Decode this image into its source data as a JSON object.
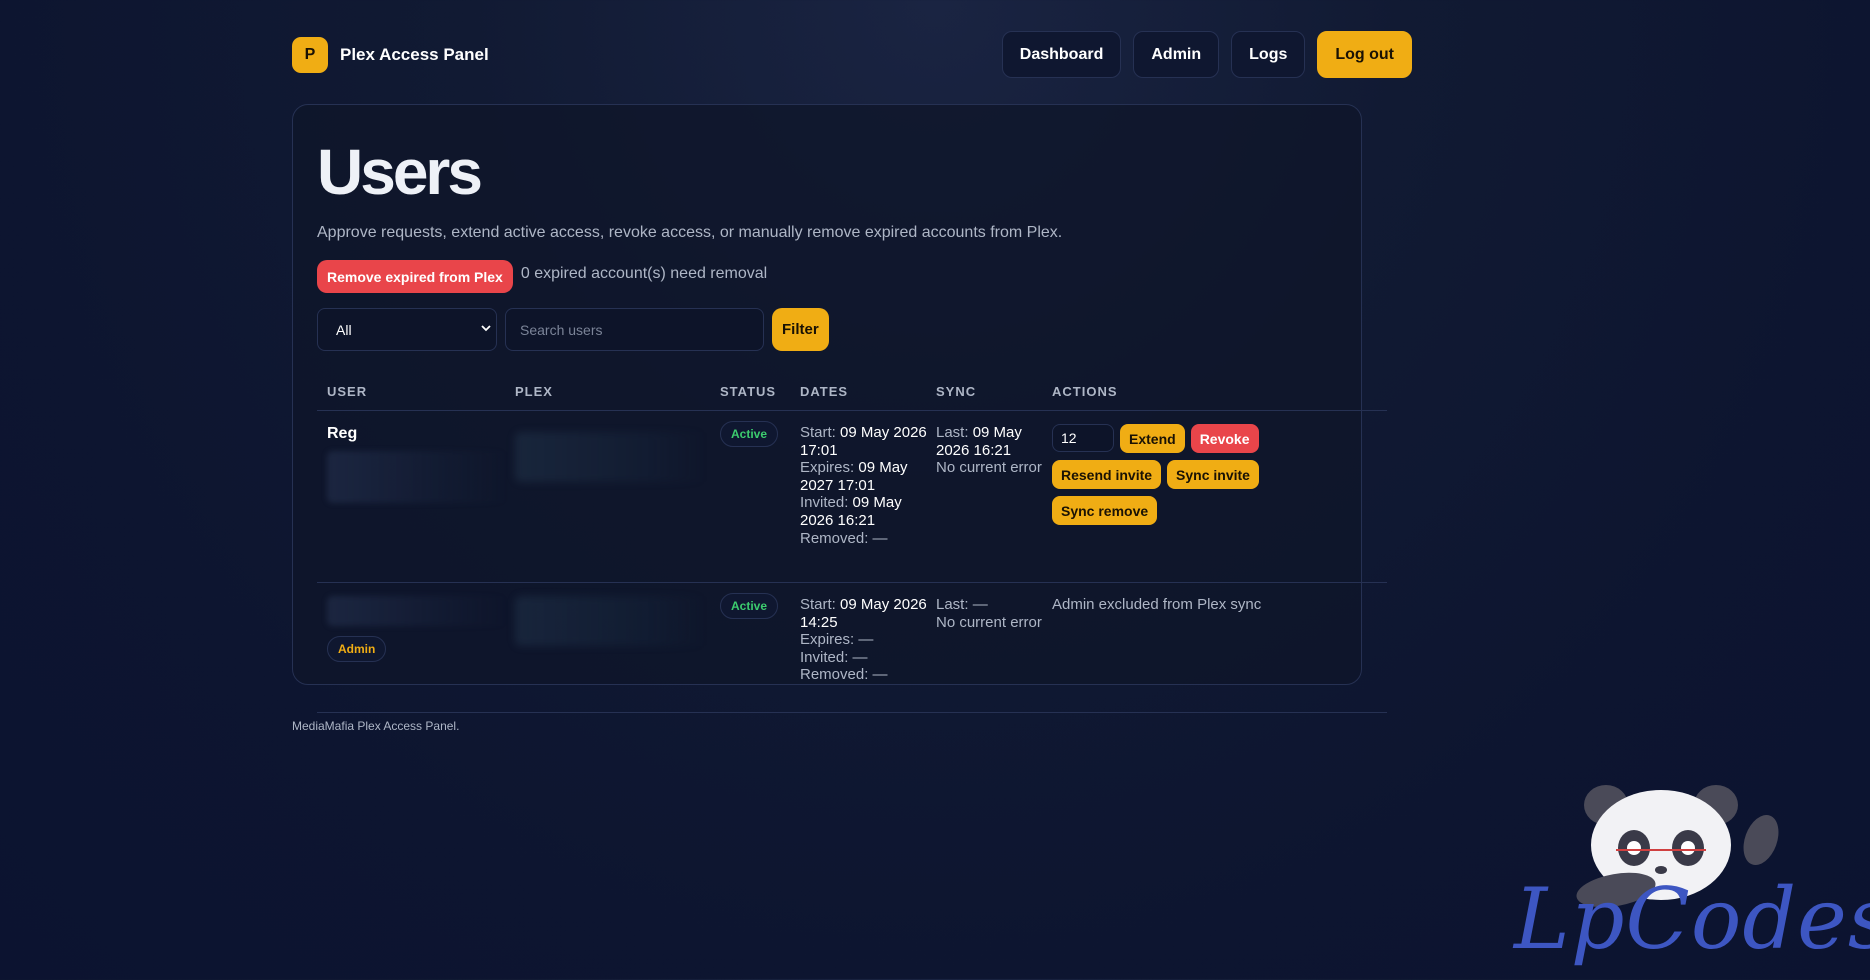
{
  "brand": {
    "logo_letter": "P",
    "name": "Plex Access Panel"
  },
  "nav": {
    "dashboard": "Dashboard",
    "admin": "Admin",
    "logs": "Logs",
    "logout": "Log out"
  },
  "page": {
    "title": "Users",
    "subtitle": "Approve requests, extend active access, revoke access, or manually remove expired accounts from Plex.",
    "remove_expired_label": "Remove expired from Plex",
    "remove_expired_info": "0 expired account(s) need removal"
  },
  "filter": {
    "selected": "All",
    "search_placeholder": "Search users",
    "button": "Filter"
  },
  "table": {
    "headers": {
      "user": "USER",
      "plex": "PLEX",
      "status": "STATUS",
      "dates": "DATES",
      "sync": "SYNC",
      "actions": "ACTIONS"
    },
    "rows": [
      {
        "user": "Reg",
        "status": "Active",
        "dates": {
          "start_label": "Start:",
          "start": "09 May 2026 17:01",
          "expires_label": "Expires:",
          "expires": "09 May 2027 17:01",
          "invited_label": "Invited:",
          "invited": "09 May 2026 16:21",
          "removed_label": "Removed:",
          "removed": "—"
        },
        "sync": {
          "last_label": "Last:",
          "last": "09 May 2026 16:21",
          "error": "No current error"
        },
        "actions": {
          "months_value": "12",
          "extend": "Extend",
          "revoke": "Revoke",
          "resend_invite": "Resend invite",
          "sync_invite": "Sync invite",
          "sync_remove": "Sync remove"
        }
      },
      {
        "user_badge": "Admin",
        "status": "Active",
        "dates": {
          "start_label": "Start:",
          "start": "09 May 2026 14:25",
          "expires_label": "Expires:",
          "expires": "—",
          "invited_label": "Invited:",
          "invited": "—",
          "removed_label": "Removed:",
          "removed": "—"
        },
        "sync": {
          "last_label": "Last:",
          "last": "—",
          "error": "No current error"
        },
        "admin_note": "Admin excluded from Plex sync"
      }
    ]
  },
  "footer": "MediaMafia Plex Access Panel.",
  "watermark": "LpCodes",
  "colors": {
    "accent": "#f0ad14",
    "danger": "#e9454a",
    "success": "#3ccc6e",
    "background": "#0d1530"
  }
}
